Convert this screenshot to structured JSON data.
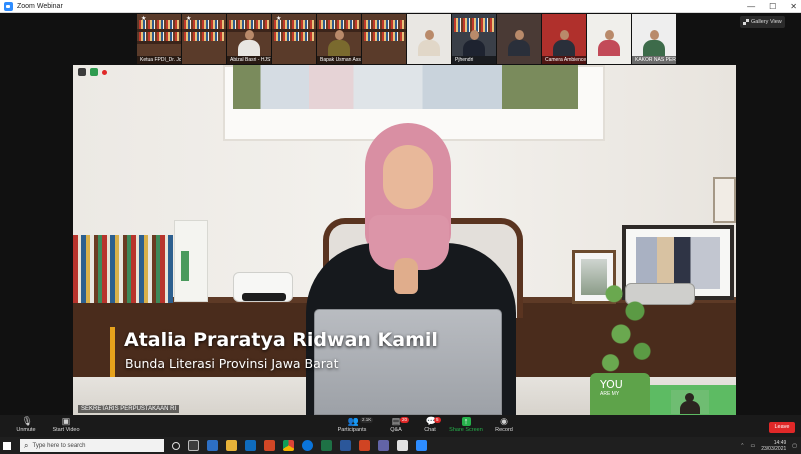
{
  "window": {
    "title": "Zoom Webinar",
    "controls": [
      "—",
      "☐",
      "✕"
    ]
  },
  "gallery": {
    "view_label": "Gallery View",
    "tiles": [
      {
        "name": "Ketua FPDI_Dr. Jon..."
      },
      {
        "name": "Abizal Basri - HJST"
      },
      {
        "name": "Bapak Usman Assbidi..."
      },
      {
        "name": "Pjhendri"
      },
      {
        "name": "Camera Ambience ..."
      },
      {
        "name": "KAKOR NAS PERPUST..."
      }
    ]
  },
  "speaker": {
    "name": "Atalia Praratya Ridwan Kamil",
    "role": "Bunda Literasi Provinsi Jawa Barat",
    "label": "SEKRETARIS PERPUSTAKAAN RI",
    "pot_text": "YOU",
    "pot_sub": "ARE MY"
  },
  "controls": {
    "unmute": "Unmute",
    "start_video": "Start Video",
    "participants": "Participants",
    "participants_count": "2.1K",
    "qa": "Q&A",
    "qa_badge": "20",
    "chat": "Chat",
    "chat_badge": "5",
    "share_screen": "Share Screen",
    "record": "Record",
    "leave": "Leave"
  },
  "taskbar": {
    "search_placeholder": "Type here to search",
    "time": "14:49",
    "date": "23/03/2021"
  },
  "colors": {
    "leave_red": "#e02828",
    "share_green": "#26b14b",
    "name_bar_gold": "#e6a21c"
  }
}
